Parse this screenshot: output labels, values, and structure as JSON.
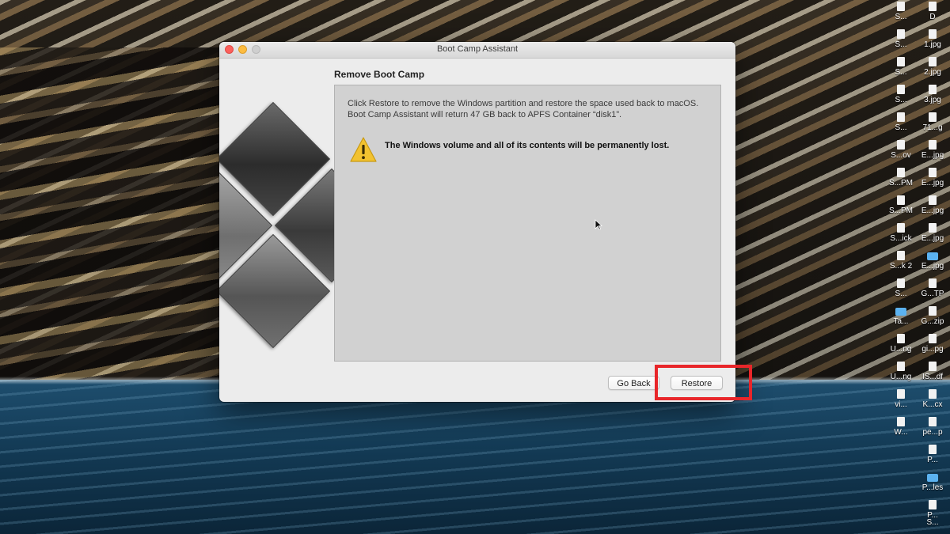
{
  "window": {
    "title": "Boot Camp Assistant",
    "section_title": "Remove Boot Camp",
    "description_line1": "Click Restore to remove the Windows partition and restore the space used back to macOS.",
    "description_line2": "Boot Camp Assistant will return 47 GB back to APFS Container “disk1”.",
    "warning_text": "The Windows volume and all of its contents will be permanently lost.",
    "go_back_label": "Go Back",
    "restore_label": "Restore",
    "icons": {
      "warning": "warning-icon",
      "logo": "boot-camp-logo"
    }
  },
  "desktop": {
    "icon_labels": [
      "S...",
      "D",
      "S...",
      "1.jpg",
      "S...",
      "2.jpg",
      "S...",
      "3.jpg",
      "S...",
      "71...g",
      "S...ov",
      "E...jpg",
      "S...PM",
      "E...jpg",
      "S...PM",
      "E...jpg",
      "S...ick",
      "E...jpg",
      "S...k 2",
      "E...jpg",
      "S...",
      "G...TP",
      "Ta...",
      "G...zip",
      "U...ng",
      "gi...pg",
      "U...ng",
      "IS...df",
      "vi...",
      "K...cx",
      "W...",
      "pe...p",
      "P...",
      "P...les",
      "P...",
      "S..."
    ]
  },
  "annotation": {
    "highlight_color": "#e8262a",
    "highlight_target": "Restore"
  }
}
